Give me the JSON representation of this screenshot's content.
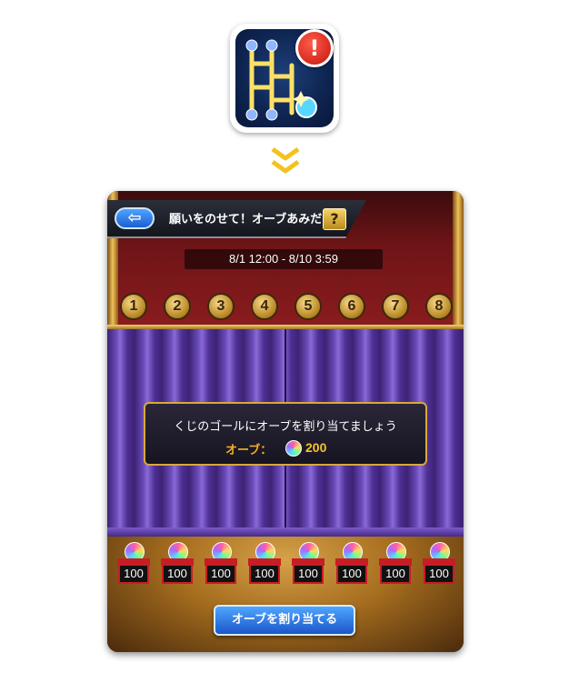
{
  "icon": {
    "name": "amidakuji-feature-icon",
    "badge_glyph": "!"
  },
  "header": {
    "back_glyph": "⇦",
    "title": "願いをのせて！オーブあみだくじ",
    "help_glyph": "?"
  },
  "event": {
    "period": "8/1 12:00 - 8/10 3:59"
  },
  "goals": [
    "1",
    "2",
    "3",
    "4",
    "5",
    "6",
    "7",
    "8"
  ],
  "dialog": {
    "message": "くじのゴールにオーブを割り当てましょう",
    "cost_label": "オーブ：",
    "cost_value": "200"
  },
  "prizes": [
    "100",
    "100",
    "100",
    "100",
    "100",
    "100",
    "100",
    "100"
  ],
  "actions": {
    "assign_label": "オーブを割り当てる"
  },
  "colors": {
    "accent_gold": "#f7b02a",
    "button_blue": "#1a56c9",
    "curtain_purple": "#4e2f94",
    "badge_red": "#c4160b"
  }
}
